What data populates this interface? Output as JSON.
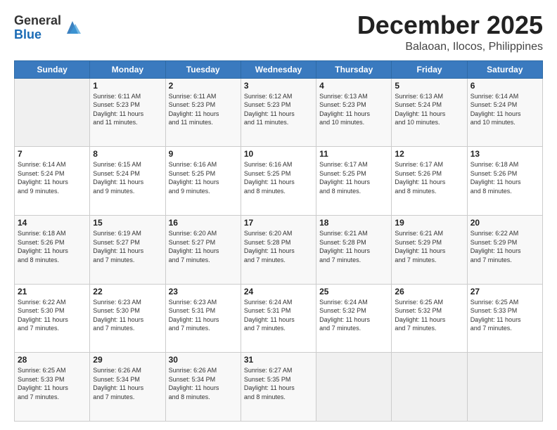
{
  "header": {
    "logo_general": "General",
    "logo_blue": "Blue",
    "month": "December 2025",
    "location": "Balaoan, Ilocos, Philippines"
  },
  "weekdays": [
    "Sunday",
    "Monday",
    "Tuesday",
    "Wednesday",
    "Thursday",
    "Friday",
    "Saturday"
  ],
  "weeks": [
    [
      {
        "day": "",
        "info": ""
      },
      {
        "day": "1",
        "info": "Sunrise: 6:11 AM\nSunset: 5:23 PM\nDaylight: 11 hours\nand 11 minutes."
      },
      {
        "day": "2",
        "info": "Sunrise: 6:11 AM\nSunset: 5:23 PM\nDaylight: 11 hours\nand 11 minutes."
      },
      {
        "day": "3",
        "info": "Sunrise: 6:12 AM\nSunset: 5:23 PM\nDaylight: 11 hours\nand 11 minutes."
      },
      {
        "day": "4",
        "info": "Sunrise: 6:13 AM\nSunset: 5:23 PM\nDaylight: 11 hours\nand 10 minutes."
      },
      {
        "day": "5",
        "info": "Sunrise: 6:13 AM\nSunset: 5:24 PM\nDaylight: 11 hours\nand 10 minutes."
      },
      {
        "day": "6",
        "info": "Sunrise: 6:14 AM\nSunset: 5:24 PM\nDaylight: 11 hours\nand 10 minutes."
      }
    ],
    [
      {
        "day": "7",
        "info": "Sunrise: 6:14 AM\nSunset: 5:24 PM\nDaylight: 11 hours\nand 9 minutes."
      },
      {
        "day": "8",
        "info": "Sunrise: 6:15 AM\nSunset: 5:24 PM\nDaylight: 11 hours\nand 9 minutes."
      },
      {
        "day": "9",
        "info": "Sunrise: 6:16 AM\nSunset: 5:25 PM\nDaylight: 11 hours\nand 9 minutes."
      },
      {
        "day": "10",
        "info": "Sunrise: 6:16 AM\nSunset: 5:25 PM\nDaylight: 11 hours\nand 8 minutes."
      },
      {
        "day": "11",
        "info": "Sunrise: 6:17 AM\nSunset: 5:25 PM\nDaylight: 11 hours\nand 8 minutes."
      },
      {
        "day": "12",
        "info": "Sunrise: 6:17 AM\nSunset: 5:26 PM\nDaylight: 11 hours\nand 8 minutes."
      },
      {
        "day": "13",
        "info": "Sunrise: 6:18 AM\nSunset: 5:26 PM\nDaylight: 11 hours\nand 8 minutes."
      }
    ],
    [
      {
        "day": "14",
        "info": "Sunrise: 6:18 AM\nSunset: 5:26 PM\nDaylight: 11 hours\nand 8 minutes."
      },
      {
        "day": "15",
        "info": "Sunrise: 6:19 AM\nSunset: 5:27 PM\nDaylight: 11 hours\nand 7 minutes."
      },
      {
        "day": "16",
        "info": "Sunrise: 6:20 AM\nSunset: 5:27 PM\nDaylight: 11 hours\nand 7 minutes."
      },
      {
        "day": "17",
        "info": "Sunrise: 6:20 AM\nSunset: 5:28 PM\nDaylight: 11 hours\nand 7 minutes."
      },
      {
        "day": "18",
        "info": "Sunrise: 6:21 AM\nSunset: 5:28 PM\nDaylight: 11 hours\nand 7 minutes."
      },
      {
        "day": "19",
        "info": "Sunrise: 6:21 AM\nSunset: 5:29 PM\nDaylight: 11 hours\nand 7 minutes."
      },
      {
        "day": "20",
        "info": "Sunrise: 6:22 AM\nSunset: 5:29 PM\nDaylight: 11 hours\nand 7 minutes."
      }
    ],
    [
      {
        "day": "21",
        "info": "Sunrise: 6:22 AM\nSunset: 5:30 PM\nDaylight: 11 hours\nand 7 minutes."
      },
      {
        "day": "22",
        "info": "Sunrise: 6:23 AM\nSunset: 5:30 PM\nDaylight: 11 hours\nand 7 minutes."
      },
      {
        "day": "23",
        "info": "Sunrise: 6:23 AM\nSunset: 5:31 PM\nDaylight: 11 hours\nand 7 minutes."
      },
      {
        "day": "24",
        "info": "Sunrise: 6:24 AM\nSunset: 5:31 PM\nDaylight: 11 hours\nand 7 minutes."
      },
      {
        "day": "25",
        "info": "Sunrise: 6:24 AM\nSunset: 5:32 PM\nDaylight: 11 hours\nand 7 minutes."
      },
      {
        "day": "26",
        "info": "Sunrise: 6:25 AM\nSunset: 5:32 PM\nDaylight: 11 hours\nand 7 minutes."
      },
      {
        "day": "27",
        "info": "Sunrise: 6:25 AM\nSunset: 5:33 PM\nDaylight: 11 hours\nand 7 minutes."
      }
    ],
    [
      {
        "day": "28",
        "info": "Sunrise: 6:25 AM\nSunset: 5:33 PM\nDaylight: 11 hours\nand 7 minutes."
      },
      {
        "day": "29",
        "info": "Sunrise: 6:26 AM\nSunset: 5:34 PM\nDaylight: 11 hours\nand 7 minutes."
      },
      {
        "day": "30",
        "info": "Sunrise: 6:26 AM\nSunset: 5:34 PM\nDaylight: 11 hours\nand 8 minutes."
      },
      {
        "day": "31",
        "info": "Sunrise: 6:27 AM\nSunset: 5:35 PM\nDaylight: 11 hours\nand 8 minutes."
      },
      {
        "day": "",
        "info": ""
      },
      {
        "day": "",
        "info": ""
      },
      {
        "day": "",
        "info": ""
      }
    ]
  ]
}
